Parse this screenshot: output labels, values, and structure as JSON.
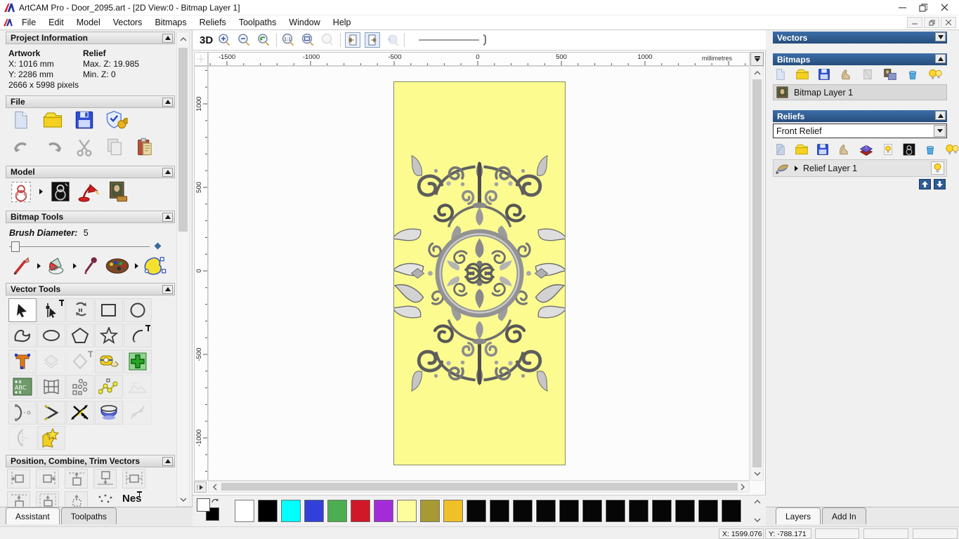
{
  "window": {
    "title": "ArtCAM Pro - Door_2095.art - [2D View:0 - Bitmap Layer 1]",
    "controls": [
      "minimize-icon",
      "restore-icon",
      "close-icon"
    ],
    "mdi_controls": [
      "minimize-icon",
      "restore-icon",
      "close-icon"
    ]
  },
  "menu": {
    "items": [
      "File",
      "Edit",
      "Model",
      "Vectors",
      "Bitmaps",
      "Reliefs",
      "Toolpaths",
      "Window",
      "Help"
    ]
  },
  "left_panel": {
    "project_information": {
      "title": "Project Information",
      "artwork_label": "Artwork",
      "artwork_x": "X: 1016 mm",
      "artwork_y": "Y: 2286 mm",
      "pixels": "2666 x 5998 pixels",
      "relief_label": "Relief",
      "relief_max": "Max. Z: 19.985",
      "relief_min": "Min. Z: 0"
    },
    "file_section": {
      "title": "File",
      "icons": [
        "new-model-icon",
        "open-model-icon",
        "save-model-icon",
        "options-icon",
        "undo-icon",
        "redo-icon",
        "cut-icon",
        "copy-icon",
        "paste-icon"
      ]
    },
    "model_section": {
      "title": "Model",
      "icons": [
        "set-model-size-icon",
        "greyscale-model-icon",
        "lighting-icon",
        "load-image-icon"
      ]
    },
    "bitmap_tools": {
      "title": "Bitmap Tools",
      "brush_diameter_label": "Brush Diameter:",
      "brush_diameter_value": "5",
      "icons": [
        "paint-icon",
        "flood-fill-icon",
        "colour-picker-icon",
        "palette-icon",
        "bitmap-to-vector-icon"
      ]
    },
    "vector_tools": {
      "title": "Vector Tools",
      "icons": [
        "select-icon",
        "node-editing-icon",
        "transform-icon",
        "rectangle-icon",
        "circle-icon",
        "polyline-icon",
        "ellipse-icon",
        "polygon-icon",
        "star-icon",
        "arc-icon",
        "text-icon",
        "offset-icon",
        "fillet-icon",
        "measure-icon",
        "snap-icon",
        "text-block-icon",
        "envelope-icon",
        "block-copy-icon",
        "join-vectors-icon",
        "disabled-tool-icon",
        "fit-arcs-icon",
        "close-vector-icon",
        "trim-vectors-icon",
        "interpolate-icon",
        "disabled-spline-icon",
        "slice-icon",
        "vector-doctor-icon"
      ]
    },
    "position_section": {
      "title": "Position, Combine, Trim Vectors",
      "nesting_label": "Nes",
      "icons": [
        "align-left-icon",
        "align-right-icon",
        "align-top-icon",
        "align-bottom-icon",
        "centre-horizontal-icon",
        "centre-top-icon",
        "centre-top-alt-icon",
        "align-centre-icon",
        "spread-icon",
        "nesting-icon"
      ]
    },
    "tabs": [
      {
        "label": "Assistant",
        "active": true
      },
      {
        "label": "Toolpaths",
        "active": false
      }
    ]
  },
  "canvas": {
    "toolbar": {
      "view_3d_label": "3D",
      "icons": [
        "view-3d-button",
        "zoom-in-icon",
        "zoom-out-icon",
        "zoom-previous-icon",
        "zoom-ratio-icon",
        "zoom-fit-icon",
        "zoom-object-icon",
        "previous-vector-icon",
        "next-vector-icon",
        "pan-zoom-icon",
        "zoom-slider"
      ]
    },
    "ruler_units": "millimetres",
    "h_ruler_labels": [
      {
        "t": "-1500",
        "p": 26
      },
      {
        "t": "-1000",
        "p": 146
      },
      {
        "t": "-500",
        "p": 265
      },
      {
        "t": "0",
        "p": 383
      },
      {
        "t": "500",
        "p": 502
      },
      {
        "t": "1000",
        "p": 621
      }
    ],
    "v_ruler_labels": [
      {
        "t": "1000",
        "p": 53
      },
      {
        "t": "500",
        "p": 172
      },
      {
        "t": "0",
        "p": 291
      },
      {
        "t": "-500",
        "p": 410
      },
      {
        "t": "-1000",
        "p": 529
      }
    ],
    "artboard_color": "#fbfb90",
    "ornament": "grey-relief-scrollwork-preview"
  },
  "right_panel": {
    "vectors": {
      "title": "Vectors"
    },
    "bitmaps": {
      "title": "Bitmaps",
      "layer": "Bitmap Layer 1",
      "toolbar": [
        "new-bitmap-icon",
        "open-bitmap-icon",
        "save-bitmap-icon",
        "texture-bitmap-icon",
        "blank-bitmap-icon",
        "merge-bitmap-icon",
        "delete-bitmap-icon",
        "toggle-visibility-icon"
      ]
    },
    "reliefs": {
      "title": "Reliefs",
      "dropdown_value": "Front Relief",
      "layer": "Relief Layer 1",
      "toolbar": [
        "new-relief-icon",
        "open-relief-icon",
        "save-relief-icon",
        "texture-relief-icon",
        "stack-relief-icon",
        "relief-visibility-icon",
        "greyscale-relief-icon",
        "delete-relief-icon",
        "toggle-all-visibility-icon"
      ]
    },
    "tabs": [
      {
        "label": "Layers",
        "active": true
      },
      {
        "label": "Add In",
        "active": false
      }
    ]
  },
  "palette": {
    "swatches": [
      "#ffffff",
      "#000000",
      "#00ffff",
      "#3040d8",
      "#4cae50",
      "#d01828",
      "#a32cd8",
      "#fdfd9e",
      "#a89a33",
      "#f0c029",
      "#060606",
      "#060606",
      "#060606",
      "#060606",
      "#060606",
      "#060606",
      "#060606",
      "#060606",
      "#060606",
      "#060606",
      "#060606",
      "#060606"
    ],
    "primary_color": "#ffffff",
    "secondary_color": "#000000"
  },
  "status_bar": {
    "fields": [
      {
        "text": "X: 1599.076"
      },
      {
        "text": "Y: -788.171"
      },
      {
        "text": ""
      },
      {
        "text": ""
      },
      {
        "text": ""
      }
    ]
  },
  "colors": {
    "header_blue": "#2e5c8f",
    "canvas_yellow": "#fbfb90",
    "panel_grey": "#f0f0f0"
  }
}
